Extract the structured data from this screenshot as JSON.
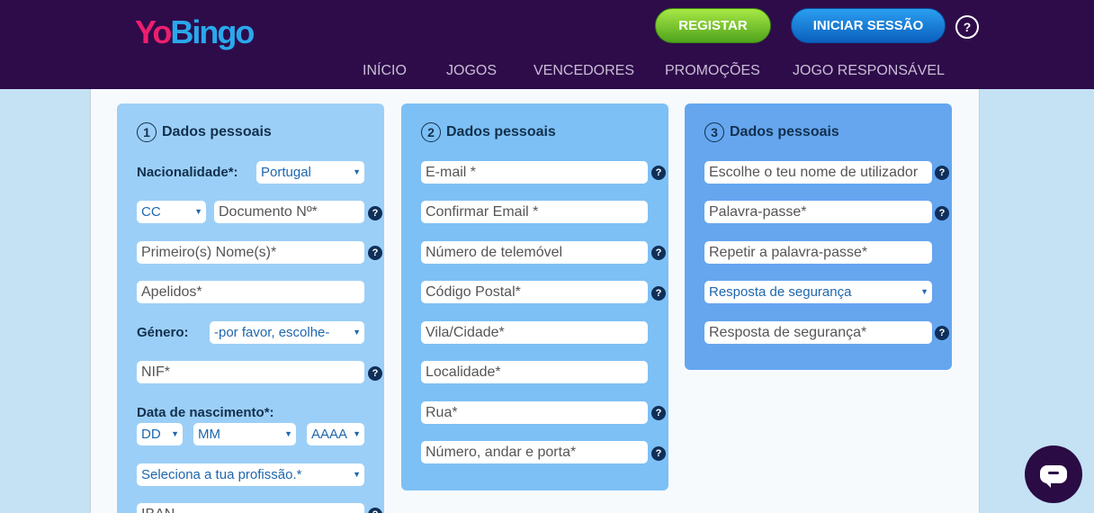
{
  "header": {
    "logo": {
      "part1": "Yo",
      "part2": "Bingo"
    },
    "register_label": "REGISTAR",
    "login_label": "INICIAR SESSÃO",
    "help_label": "?",
    "nav": [
      "INÍCIO",
      "JOGOS",
      "VENCEDORES",
      "PROMOÇÕES",
      "JOGO RESPONSÁVEL"
    ]
  },
  "help_icon": "?",
  "panel1": {
    "number": "1",
    "title": "Dados pessoais",
    "nationality_label": "Nacionalidade*:",
    "nationality_value": "Portugal",
    "doc_type": "CC",
    "doc_number_placeholder": "Documento Nº*",
    "first_name_placeholder": "Primeiro(s) Nome(s)*",
    "last_name_placeholder": "Apelidos*",
    "gender_label": "Género:",
    "gender_value": "-por favor, escolhe-",
    "nif_placeholder": "NIF*",
    "birth_label": "Data de nascimento*:",
    "day": "DD",
    "month": "MM",
    "year": "AAAA",
    "profession_value": "Seleciona a tua profissão.*",
    "iban_placeholder": "IBAN"
  },
  "panel2": {
    "number": "2",
    "title": "Dados pessoais",
    "email_placeholder": "E-mail *",
    "confirm_email_placeholder": "Confirmar Email *",
    "phone_placeholder": "Número de telemóvel",
    "postal_placeholder": "Código Postal*",
    "city_placeholder": "Vila/Cidade*",
    "locality_placeholder": "Localidade*",
    "street_placeholder": "Rua*",
    "number_placeholder": "Número, andar e porta*"
  },
  "panel3": {
    "number": "3",
    "title": "Dados pessoais",
    "username_placeholder": "Escolhe o teu nome de utilizador",
    "password_placeholder": "Palavra-passe*",
    "repeat_password_placeholder": "Repetir a palavra-passe*",
    "security_question_value": "Resposta de segurança",
    "security_answer_placeholder": "Resposta de segurança*"
  },
  "colors": {
    "header_bg": "#2e0c4a",
    "panel1_bg": "#9ccff7",
    "panel2_bg": "#7dc0f5",
    "panel3_bg": "#65a6ef",
    "register_green": "#4fa31d",
    "login_blue": "#0b5fbe"
  }
}
